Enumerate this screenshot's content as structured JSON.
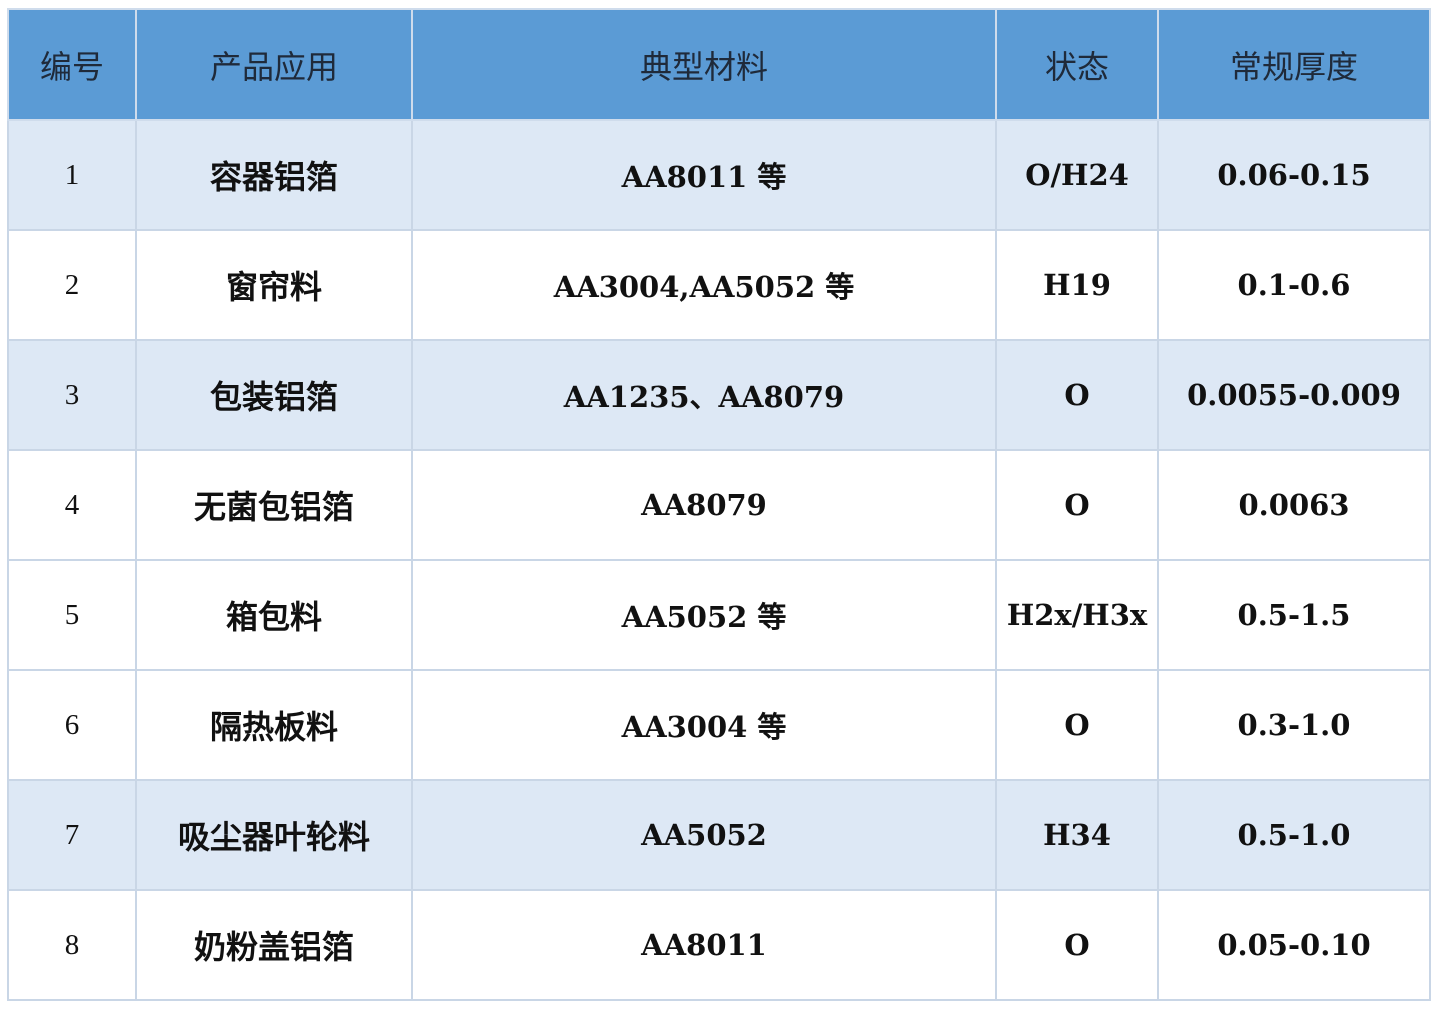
{
  "table": {
    "headers": [
      "编号",
      "产品应用",
      "典型材料",
      "状态",
      "常规厚度"
    ],
    "rows": [
      {
        "no": "1",
        "application": "容器铝箔",
        "material": "AA8011 等",
        "temper": "O/H24",
        "thickness": "0.06-0.15",
        "shaded": true
      },
      {
        "no": "2",
        "application": "窗帘料",
        "material": "AA3004,AA5052 等",
        "temper": "H19",
        "thickness": "0.1-0.6",
        "shaded": false
      },
      {
        "no": "3",
        "application": "包装铝箔",
        "material": "AA1235、AA8079",
        "temper": "O",
        "thickness": "0.0055-0.009",
        "shaded": true
      },
      {
        "no": "4",
        "application": "无菌包铝箔",
        "material": "AA8079",
        "temper": "O",
        "thickness": "0.0063",
        "shaded": false
      },
      {
        "no": "5",
        "application": "箱包料",
        "material": "AA5052 等",
        "temper": "H2x/H3x",
        "thickness": "0.5-1.5",
        "shaded": false
      },
      {
        "no": "6",
        "application": "隔热板料",
        "material": "AA3004 等",
        "temper": "O",
        "thickness": "0.3-1.0",
        "shaded": false
      },
      {
        "no": "7",
        "application": "吸尘器叶轮料",
        "material": "AA5052",
        "temper": "H34",
        "thickness": "0.5-1.0",
        "shaded": true
      },
      {
        "no": "8",
        "application": "奶粉盖铝箔",
        "material": "AA8011",
        "temper": "O",
        "thickness": "0.05-0.10",
        "shaded": false
      }
    ]
  },
  "colors": {
    "header_bg": "#5b9bd5",
    "shaded_row_bg": "#dde8f5",
    "plain_row_bg": "#ffffff",
    "border": "#c9d6e6"
  }
}
